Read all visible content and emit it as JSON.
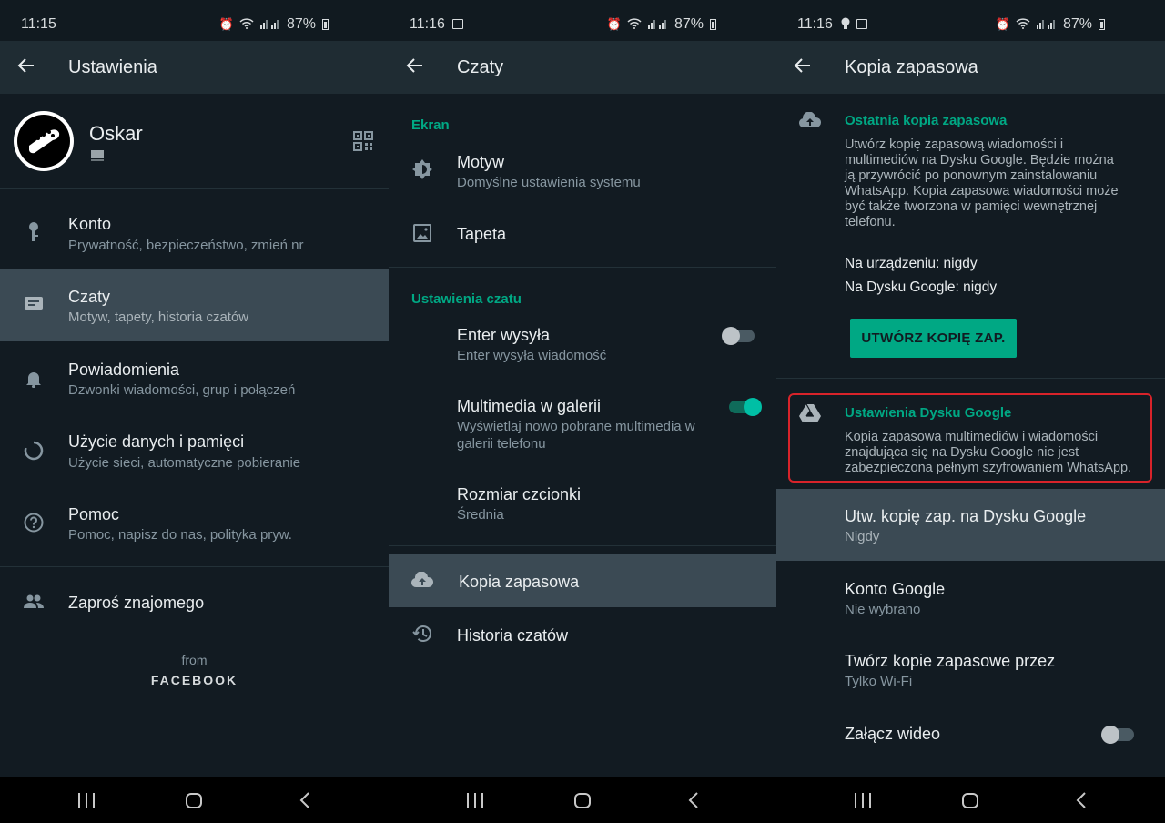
{
  "panel1": {
    "status": {
      "time": "11:15",
      "battery": "87%"
    },
    "toolbar": {
      "title": "Ustawienia"
    },
    "profile": {
      "name": "Oskar"
    },
    "items": [
      {
        "title": "Konto",
        "subtitle": "Prywatność, bezpieczeństwo, zmień nr",
        "icon": "key-icon"
      },
      {
        "title": "Czaty",
        "subtitle": "Motyw, tapety, historia czatów",
        "icon": "chat-icon"
      },
      {
        "title": "Powiadomienia",
        "subtitle": "Dzwonki wiadomości, grup i połączeń",
        "icon": "bell-icon"
      },
      {
        "title": "Użycie danych i pamięci",
        "subtitle": "Użycie sieci, automatyczne pobieranie",
        "icon": "data-usage-icon"
      },
      {
        "title": "Pomoc",
        "subtitle": "Pomoc, napisz do nas, polityka pryw.",
        "icon": "help-icon"
      }
    ],
    "invite": "Zaproś znajomego",
    "footer": {
      "from": "from",
      "brand": "FACEBOOK"
    }
  },
  "panel2": {
    "status": {
      "time": "11:16",
      "battery": "87%"
    },
    "toolbar": {
      "title": "Czaty"
    },
    "section_screen": "Ekran",
    "motyw": {
      "title": "Motyw",
      "subtitle": "Domyślne ustawienia systemu"
    },
    "tapeta": {
      "title": "Tapeta"
    },
    "section_chat": "Ustawienia czatu",
    "enter": {
      "title": "Enter wysyła",
      "subtitle": "Enter wysyła wiadomość",
      "enabled": false
    },
    "media": {
      "title": "Multimedia w galerii",
      "subtitle_1": "Wyświetlaj nowo pobrane multimedia w",
      "subtitle_2": "galerii telefonu",
      "enabled": true
    },
    "font": {
      "title": "Rozmiar czcionki",
      "subtitle": "Średnia"
    },
    "backup": {
      "title": "Kopia zapasowa"
    },
    "history": {
      "title": "Historia czatów"
    }
  },
  "panel3": {
    "status": {
      "time": "11:16",
      "battery": "87%"
    },
    "toolbar": {
      "title": "Kopia zapasowa"
    },
    "last_backup": {
      "heading": "Ostatnia kopia zapasowa",
      "lines": [
        "Utwórz kopię zapasową wiadomości i",
        "multimediów na Dysku Google. Będzie można",
        "ją przywrócić po ponownym zainstalowaniu",
        "WhatsApp. Kopia zapasowa wiadomości może",
        "być także tworzona w pamięci wewnętrznej",
        "telefonu."
      ],
      "device": "Na urządzeniu: nigdy",
      "drive": "Na Dysku Google: nigdy",
      "button": "UTWÓRZ KOPIĘ ZAP."
    },
    "drive_settings": {
      "heading": "Ustawienia Dysku Google",
      "lines": [
        "Kopia zapasowa multimediów i wiadomości",
        "znajdująca się na Dysku Google nie jest",
        "zabezpieczona pełnym szyfrowaniem WhatsApp."
      ]
    },
    "backup_to_drive": {
      "title": "Utw. kopię zap. na Dysku Google",
      "subtitle": "Nigdy"
    },
    "google_account": {
      "title": "Konto Google",
      "subtitle": "Nie wybrano"
    },
    "backup_over": {
      "title": "Twórz kopie zapasowe przez",
      "subtitle": "Tylko Wi-Fi"
    },
    "include_video": {
      "title": "Załącz wideo",
      "enabled": false
    }
  },
  "colors": {
    "accent": "#00a884",
    "background": "#121b22",
    "toolbar": "#1f2c33",
    "highlight": "#3b4a54",
    "alert": "#d8232a"
  }
}
